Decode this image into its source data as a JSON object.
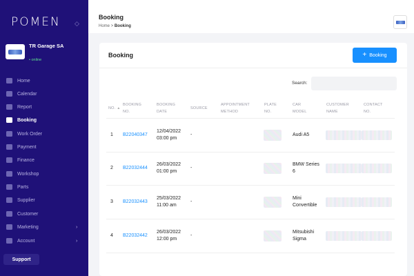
{
  "sidebar": {
    "logo": "POMEN",
    "collapse_icon": "double-chevron-icon",
    "garage": {
      "name": "TR Garage SA",
      "status": "• online"
    },
    "items": [
      {
        "label": "Home",
        "icon": "home-icon"
      },
      {
        "label": "Calendar",
        "icon": "calendar-icon"
      },
      {
        "label": "Report",
        "icon": "chart-icon"
      },
      {
        "label": "Booking",
        "icon": "booking-icon",
        "active": true
      },
      {
        "label": "Work Order",
        "icon": "document-icon"
      },
      {
        "label": "Payment",
        "icon": "payment-icon"
      },
      {
        "label": "Finance",
        "icon": "finance-icon"
      },
      {
        "label": "Workshop",
        "icon": "workshop-icon"
      },
      {
        "label": "Parts",
        "icon": "tools-icon"
      },
      {
        "label": "Supplier",
        "icon": "supplier-icon"
      },
      {
        "label": "Customer",
        "icon": "customer-icon"
      },
      {
        "label": "Marketing",
        "icon": "marketing-icon",
        "chevron": "›"
      },
      {
        "label": "Account",
        "icon": "account-icon",
        "chevron": "›"
      }
    ],
    "support_label": "Support"
  },
  "header": {
    "title": "Booking",
    "breadcrumb_home": "Home",
    "breadcrumb_sep": ">",
    "breadcrumb_current": "Booking"
  },
  "card": {
    "title": "Booking",
    "add_button_label": "Booking",
    "search_label": "Search:",
    "search_value": ""
  },
  "table": {
    "columns": [
      {
        "line1": "NO.",
        "line2": ""
      },
      {
        "line1": "BOOKING",
        "line2": "NO."
      },
      {
        "line1": "BOOKING",
        "line2": "DATE"
      },
      {
        "line1": "SOURCE",
        "line2": ""
      },
      {
        "line1": "APPOINTMENT",
        "line2": "METHOD"
      },
      {
        "line1": "PLATE",
        "line2": "NO."
      },
      {
        "line1": "CAR",
        "line2": "MODEL"
      },
      {
        "line1": "CUSTOMER",
        "line2": "NAME"
      },
      {
        "line1": "CONTACT",
        "line2": "NO."
      }
    ],
    "sort_icon": "▲",
    "rows": [
      {
        "no": "1",
        "booking_no": "B22040347",
        "date": "12/04/2022",
        "time": "03:00 pm",
        "source": "-",
        "car_line1": "Audi A5",
        "car_line2": ""
      },
      {
        "no": "2",
        "booking_no": "B22032444",
        "date": "26/03/2022",
        "time": "01:00 pm",
        "source": "-",
        "car_line1": "BMW Series",
        "car_line2": "6"
      },
      {
        "no": "3",
        "booking_no": "B22032443",
        "date": "25/03/2022",
        "time": "11:00 am",
        "source": "-",
        "car_line1": "Mini",
        "car_line2": "Convertible"
      },
      {
        "no": "4",
        "booking_no": "B22032442",
        "date": "26/03/2022",
        "time": "12:00 pm",
        "source": "-",
        "car_line1": "Mitsubishi",
        "car_line2": "Sigma"
      }
    ]
  }
}
